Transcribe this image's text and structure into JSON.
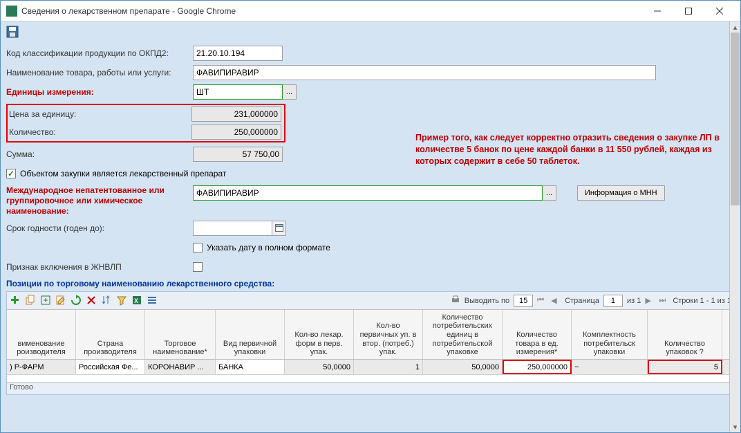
{
  "title": "Сведения о лекарственном препарате - Google Chrome",
  "labels": {
    "okpd2": "Код классификации продукции по ОКПД2:",
    "name": "Наименование товара, работы или услуги:",
    "units": "Единицы измерения:",
    "price": "Цена за единицу:",
    "qty": "Количество:",
    "sum": "Сумма:",
    "is_drug": "Объектом закупки является лекарственный препарат",
    "mnn": "Международное непатентованное или группировочное или химическое наименование:",
    "expiry": "Срок годности (годен до):",
    "full_date": "Указать дату в полном формате",
    "vital": "Признак включения в ЖНВЛП",
    "positions": "Позиции по торговому наименованию лекарственного средства:"
  },
  "values": {
    "okpd2": "21.20.10.194",
    "name": "ФАВИПИРАВИР",
    "units": "ШТ",
    "price": "231,000000",
    "qty": "250,000000",
    "sum": "57 750,00",
    "mnn": "ФАВИПИРАВИР"
  },
  "buttons": {
    "mnn_info": "Информация о МНН"
  },
  "example": "Пример того, как следует корректно отразить сведения о закупке ЛП в количестве 5 банок по цене каждой банки в 11 550 рублей, каждая из которых содержит в себе 50 таблеток.",
  "grid": {
    "output_by_label": "Выводить по",
    "output_by": "15",
    "page_label": "Страница",
    "page": "1",
    "page_of": "из 1",
    "rows_label": "Строки 1 - 1 из 1",
    "headers": {
      "c1": "вименование роизводителя",
      "c2": "Страна производителя",
      "c3": "Торговое наименование*",
      "c4": "Вид первичной упаковки",
      "c5": "Кол-во лекар. форм в перв. упак.",
      "c6": "Кол-во первичных уп. в втор. (потреб.) упак.",
      "c7": "Количество потребительских единиц в потребительской упаковке",
      "c8": "Количество товара в ед. измерения*",
      "c9": "Комплектность потребительск упаковки",
      "c10": "Количество упаковок ?"
    },
    "row": {
      "c1": ") Р-ФАРМ",
      "c2": "Российская Фе...",
      "c3": "КОРОНАВИР ...",
      "c4": "БАНКА",
      "c5": "50,0000",
      "c6": "1",
      "c7": "50,0000",
      "c8": "250,000000",
      "c9": "~",
      "c10": "5"
    }
  },
  "status": "Готово",
  "chart_data": null
}
